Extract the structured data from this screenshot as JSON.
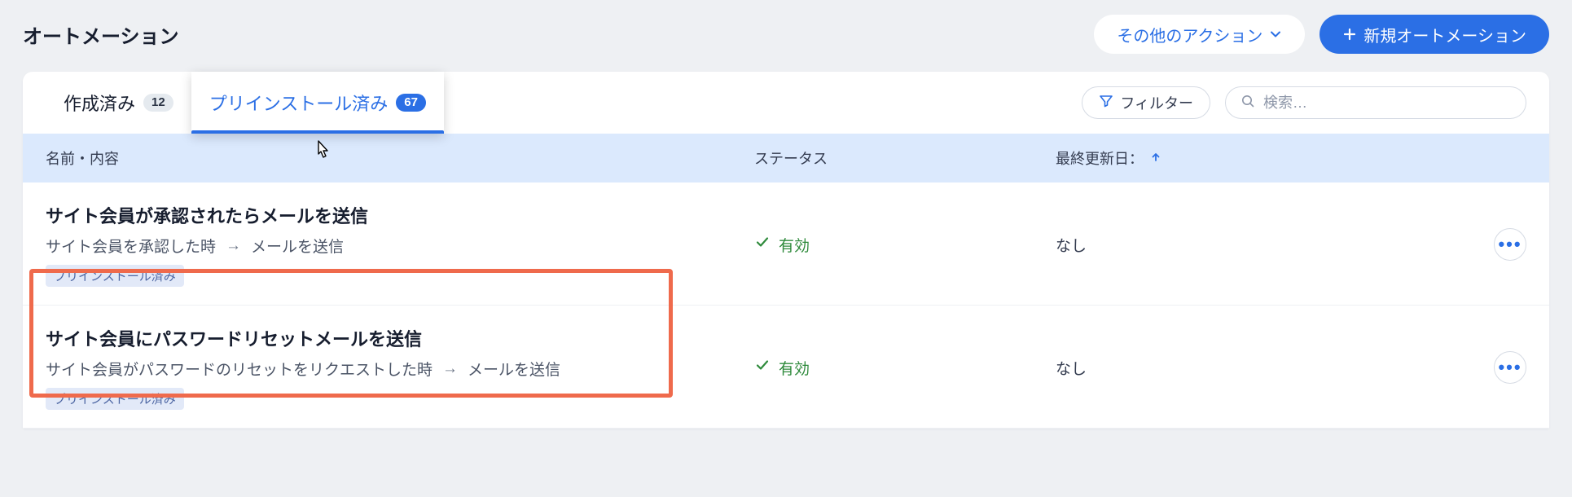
{
  "header": {
    "title": "オートメーション",
    "actions": {
      "other_label": "その他のアクション",
      "new_label": "新規オートメーション"
    }
  },
  "tabs": {
    "created": {
      "label": "作成済み",
      "count": "12"
    },
    "preinstalled": {
      "label": "プリインストール済み",
      "count": "67"
    }
  },
  "filter": {
    "label": "フィルター"
  },
  "search": {
    "placeholder": "検索…"
  },
  "columns": {
    "name": "名前・内容",
    "status": "ステータス",
    "updated": "最終更新日："
  },
  "rows": [
    {
      "title": "サイト会員が承認されたらメールを送信",
      "trigger": "サイト会員を承認した時",
      "action": "メールを送信",
      "tag": "プリインストール済み",
      "status": "有効",
      "updated": "なし"
    },
    {
      "title": "サイト会員にパスワードリセットメールを送信",
      "trigger": "サイト会員がパスワードのリセットをリクエストした時",
      "action": "メールを送信",
      "tag": "プリインストール済み",
      "status": "有効",
      "updated": "なし"
    }
  ],
  "glyphs": {
    "arrow": "→",
    "dots": "•••"
  }
}
